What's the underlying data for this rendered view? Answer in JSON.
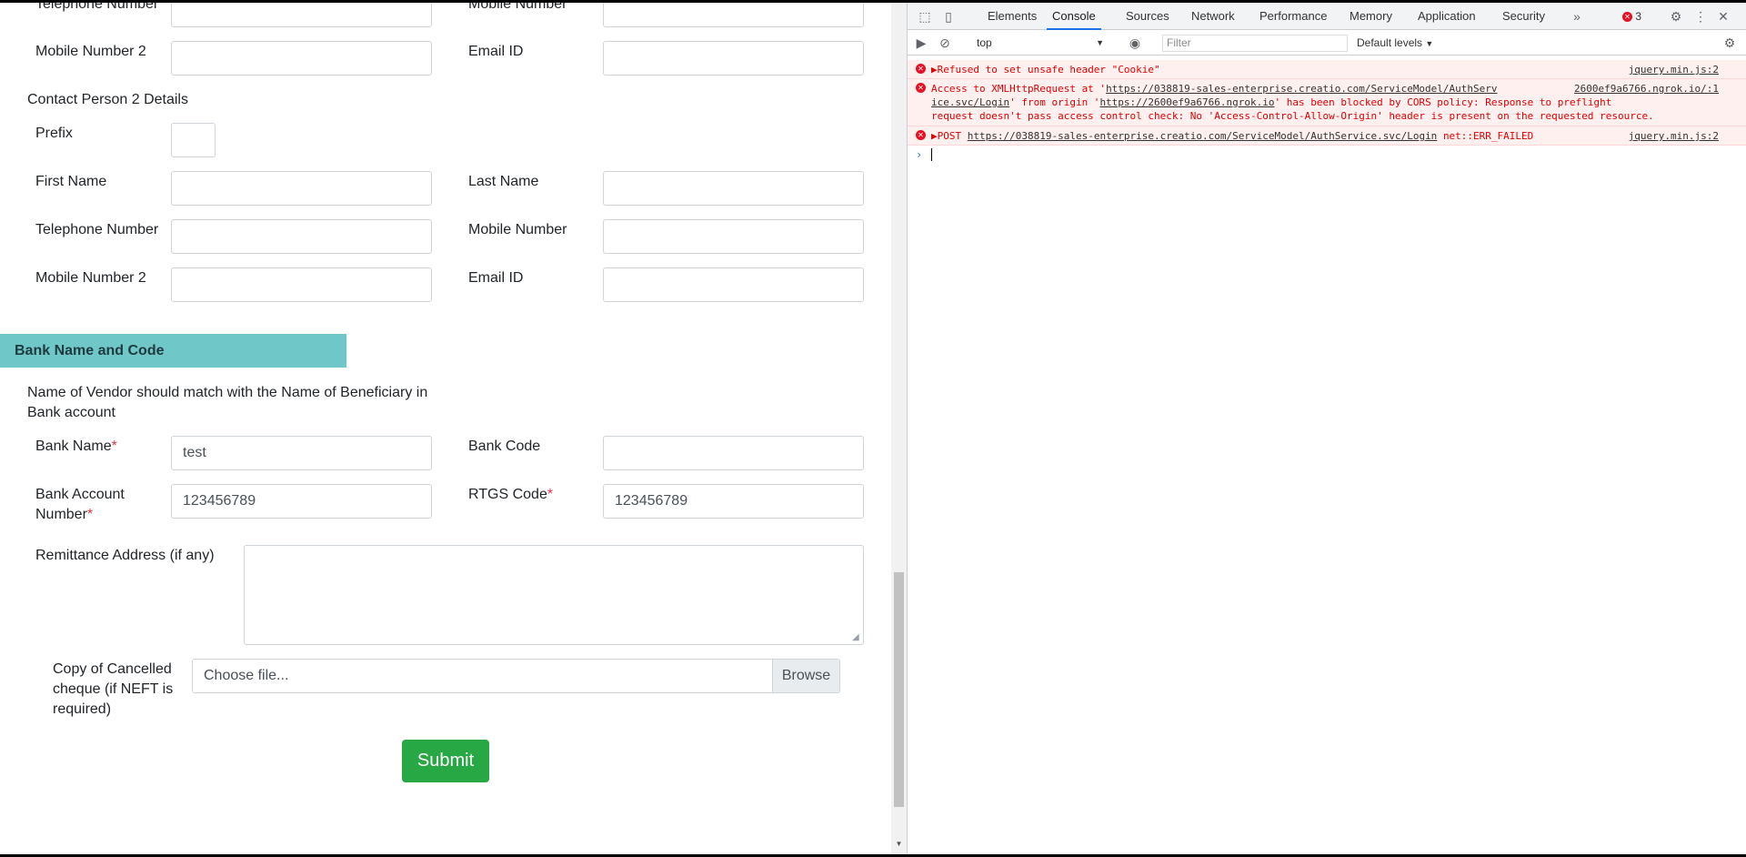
{
  "form": {
    "row_top": {
      "left_label": "Telephone Number",
      "right_label": "Mobile Number"
    },
    "row_mobile2_a": {
      "left_label": "Mobile Number 2",
      "right_label": "Email ID"
    },
    "contact2": {
      "heading": "Contact Person 2 Details",
      "prefix_label": "Prefix",
      "first_name_label": "First Name",
      "last_name_label": "Last Name",
      "telephone_label": "Telephone Number",
      "mobile_label": "Mobile Number",
      "mobile2_label": "Mobile Number 2",
      "email_label": "Email ID"
    },
    "bank": {
      "section_title": "Bank Name and Code",
      "note_line1": "Name of Vendor should match with the Name of Beneficiary in",
      "note_line2": "Bank account",
      "bank_name_label": "Bank Name",
      "bank_name_value": "test",
      "bank_code_label": "Bank Code",
      "account_label_1": "Bank Account",
      "account_label_2": "Number",
      "account_value": "123456789",
      "rtgs_label": "RTGS Code",
      "rtgs_value": "123456789",
      "required_mark": "*",
      "remittance_label": "Remittance Address (if any)",
      "cheque_label_1": "Copy of Cancelled",
      "cheque_label_2": "cheque (if NEFT is",
      "cheque_label_3": "required)",
      "file_placeholder": "Choose file...",
      "browse_label": "Browse"
    },
    "submit_label": "Submit"
  },
  "devtools": {
    "tabs": [
      "Elements",
      "Console",
      "Sources",
      "Network",
      "Performance",
      "Memory",
      "Application",
      "Security"
    ],
    "active_tab": "Console",
    "error_count": "3",
    "context": "top",
    "filter_placeholder": "Filter",
    "levels": "Default levels",
    "messages": [
      {
        "text": "Refused to set unsafe header \"Cookie\"",
        "source": "jquery.min.js:2"
      },
      {
        "line1_a": "Access to XMLHttpRequest at '",
        "line1_url": "https://038819-sales-enterprise.creatio.com/ServiceModel/AuthServ",
        "line1_src": "2600ef9a6766.ngrok.io/:1",
        "line2_url": "ice.svc/Login",
        "line2_b": "' from origin '",
        "line2_origin": "https://2600ef9a6766.ngrok.io",
        "line2_c": "' has been blocked by CORS policy: Response to preflight",
        "line3": "request doesn't pass access control check: No 'Access-Control-Allow-Origin' header is present on the requested resource."
      },
      {
        "method": "POST",
        "url": "https://038819-sales-enterprise.creatio.com/ServiceModel/AuthService.svc/Login",
        "status": "net::ERR_FAILED",
        "source": "jquery.min.js:2"
      }
    ]
  },
  "colors": {
    "banner": "#6fc8c7",
    "submit": "#28a745",
    "required": "#dc3545",
    "console_error": "#e20000",
    "accent": "#1a73e8"
  }
}
